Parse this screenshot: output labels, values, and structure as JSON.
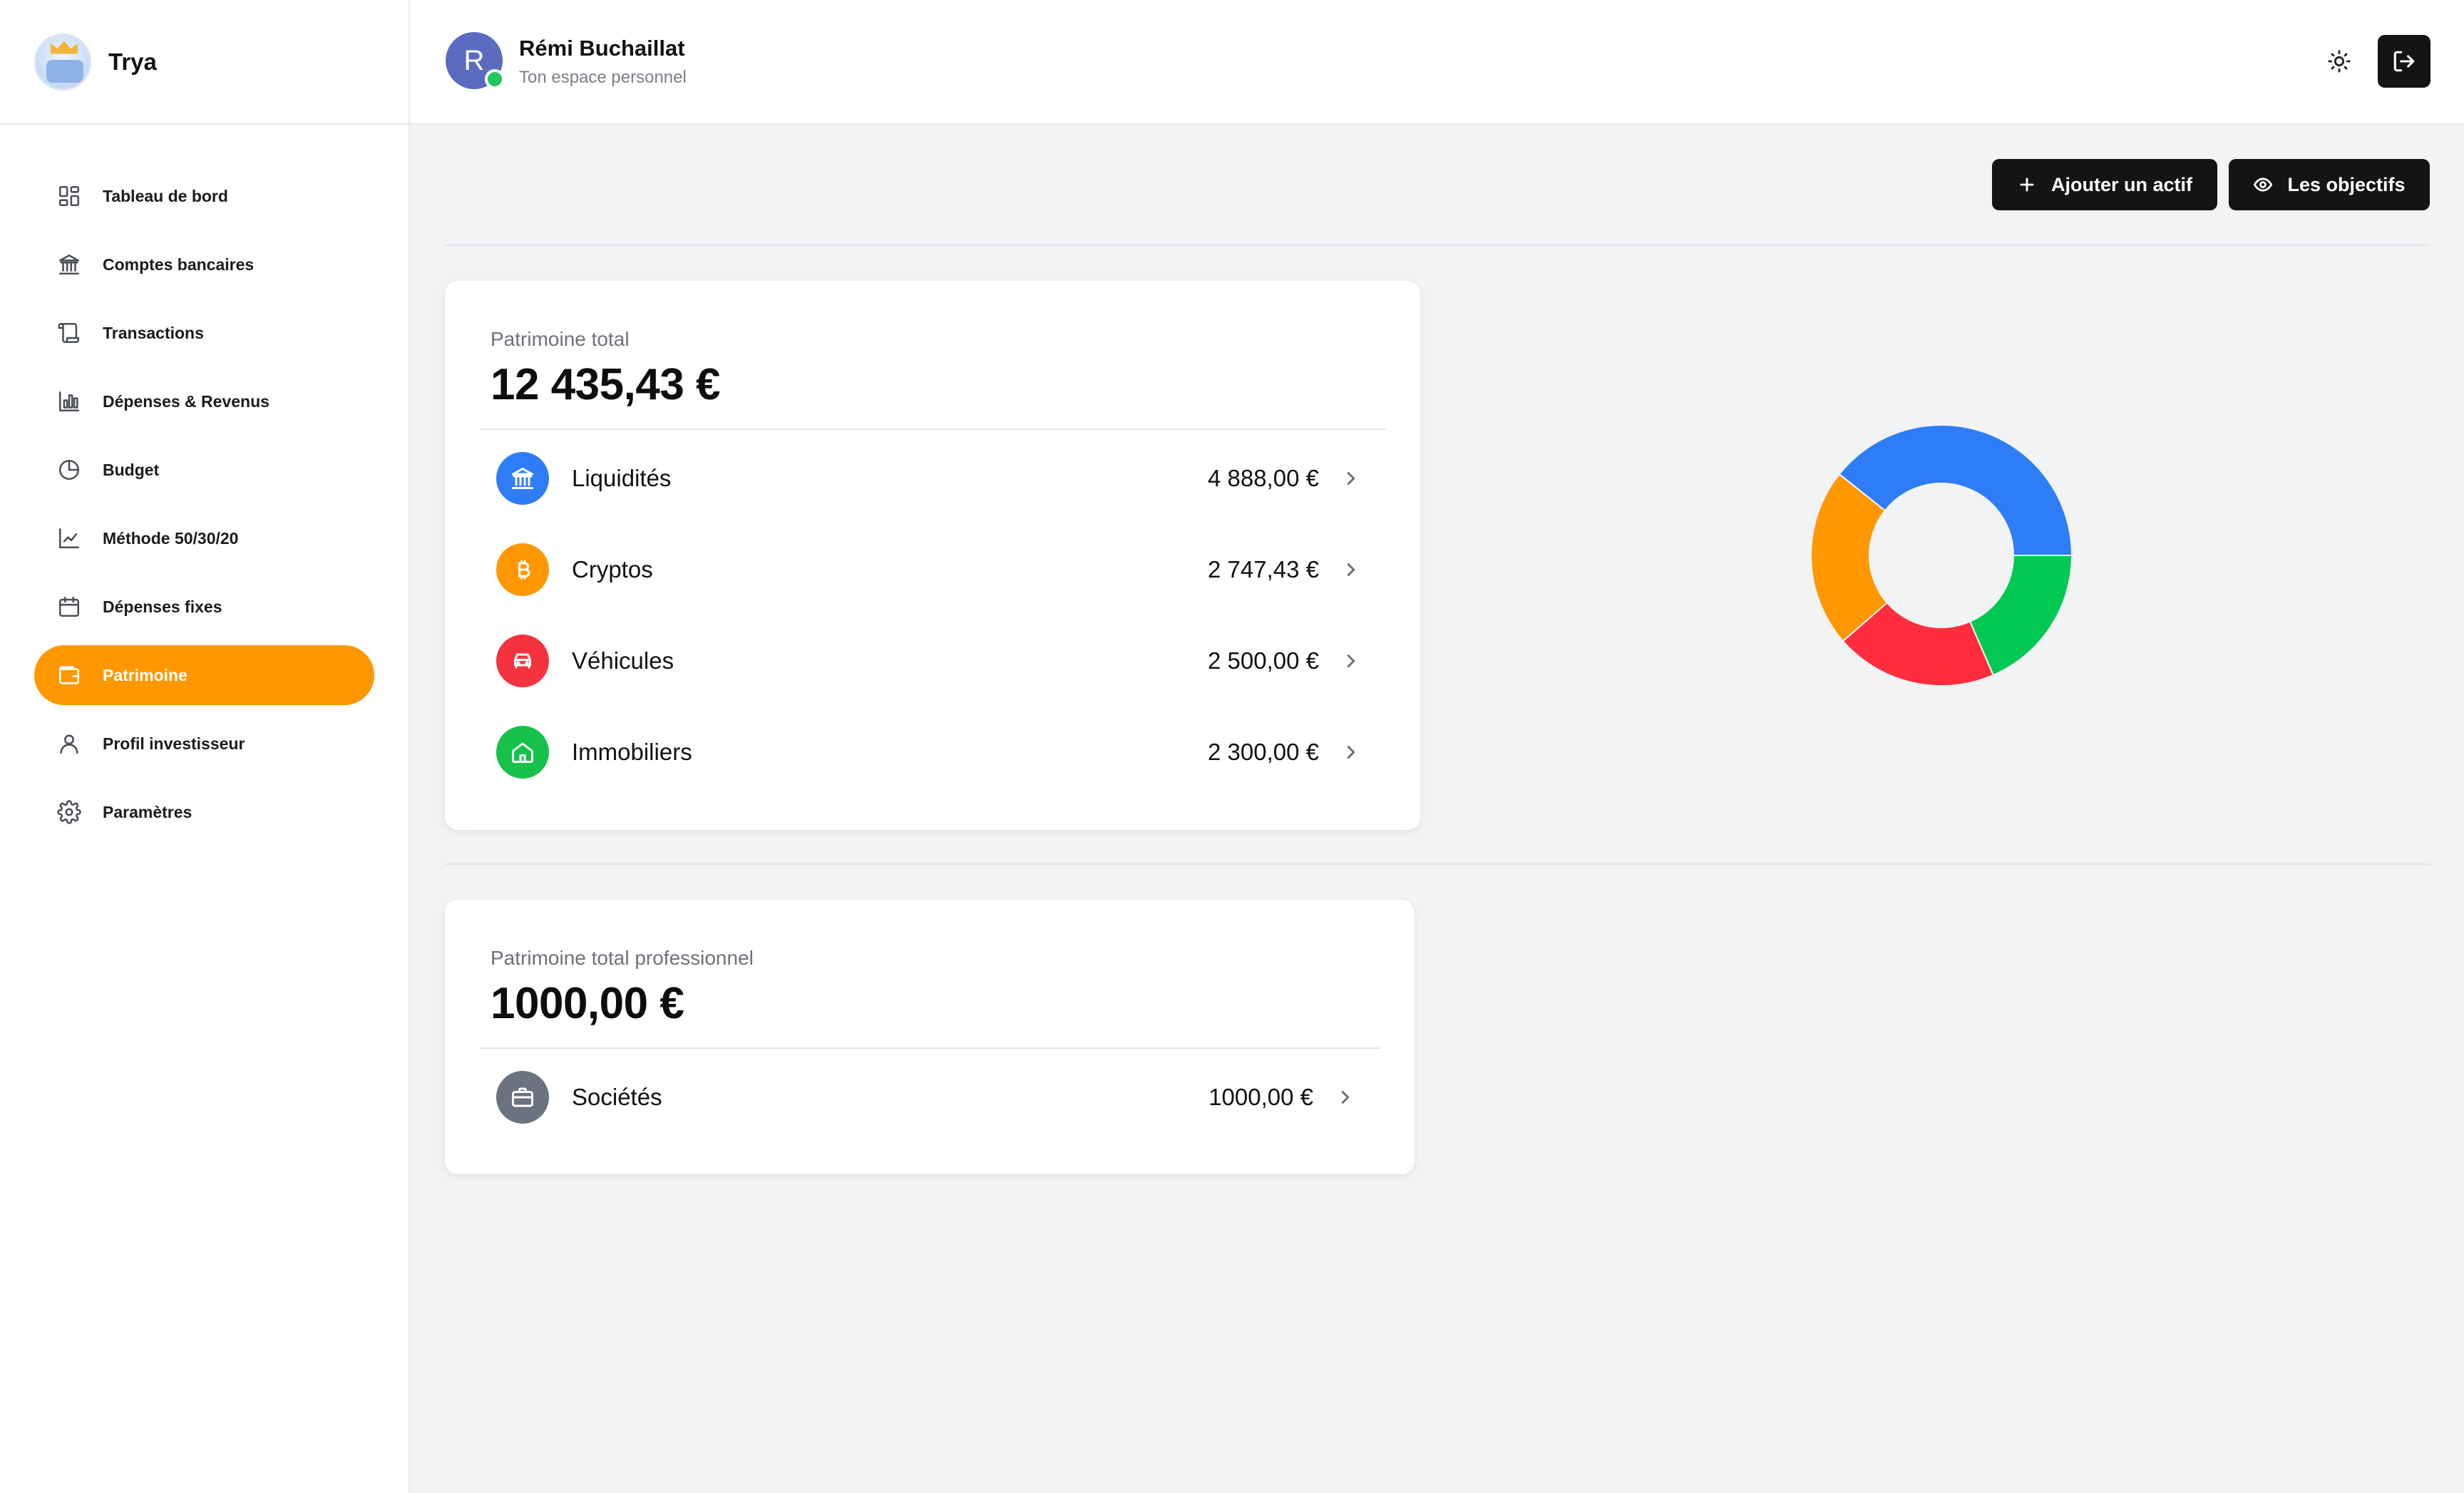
{
  "brand": {
    "name": "Trya"
  },
  "sidebar": {
    "items": [
      {
        "label": "Tableau de bord",
        "icon": "dashboard-icon"
      },
      {
        "label": "Comptes bancaires",
        "icon": "bank-icon"
      },
      {
        "label": "Transactions",
        "icon": "scroll-icon"
      },
      {
        "label": "Dépenses & Revenus",
        "icon": "bar-chart-icon"
      },
      {
        "label": "Budget",
        "icon": "pie-chart-icon"
      },
      {
        "label": "Méthode 50/30/20",
        "icon": "line-chart-icon"
      },
      {
        "label": "Dépenses fixes",
        "icon": "calendar-icon"
      },
      {
        "label": "Patrimoine",
        "icon": "wallet-icon",
        "active": true
      },
      {
        "label": "Profil investisseur",
        "icon": "user-icon"
      },
      {
        "label": "Paramètres",
        "icon": "gear-icon"
      }
    ]
  },
  "header": {
    "avatar_letter": "R",
    "user_name": "Rémi Buchaillat",
    "user_subtitle": "Ton espace personnel"
  },
  "actions": {
    "add_label": "Ajouter un actif",
    "goals_label": "Les objectifs"
  },
  "personal": {
    "label": "Patrimoine total",
    "total": "12 435,43 €",
    "rows": [
      {
        "name": "Liquidités",
        "amount": "4 888,00 €",
        "icon": "bank-icon",
        "color": "#2f7df6"
      },
      {
        "name": "Cryptos",
        "amount": "2 747,43 €",
        "icon": "bitcoin-icon",
        "color": "#ff9800"
      },
      {
        "name": "Véhicules",
        "amount": "2 500,00 €",
        "icon": "car-icon",
        "color": "#f5333f"
      },
      {
        "name": "Immobiliers",
        "amount": "2 300,00 €",
        "icon": "home-icon",
        "color": "#16c24b"
      }
    ]
  },
  "professional": {
    "label": "Patrimoine total professionnel",
    "total": "1000,00 €",
    "rows": [
      {
        "name": "Sociétés",
        "amount": "1000,00 €",
        "icon": "briefcase-icon",
        "color": "#6b7280"
      }
    ]
  },
  "chart_data": {
    "type": "pie",
    "donut": true,
    "categories": [
      "Liquidités",
      "Immobiliers",
      "Véhicules",
      "Cryptos"
    ],
    "values": [
      4888.0,
      2300.0,
      2500.0,
      2747.43
    ],
    "colors": [
      "#2f7df6",
      "#00c853",
      "#ff2d3d",
      "#ff9800"
    ],
    "legend": "none"
  }
}
